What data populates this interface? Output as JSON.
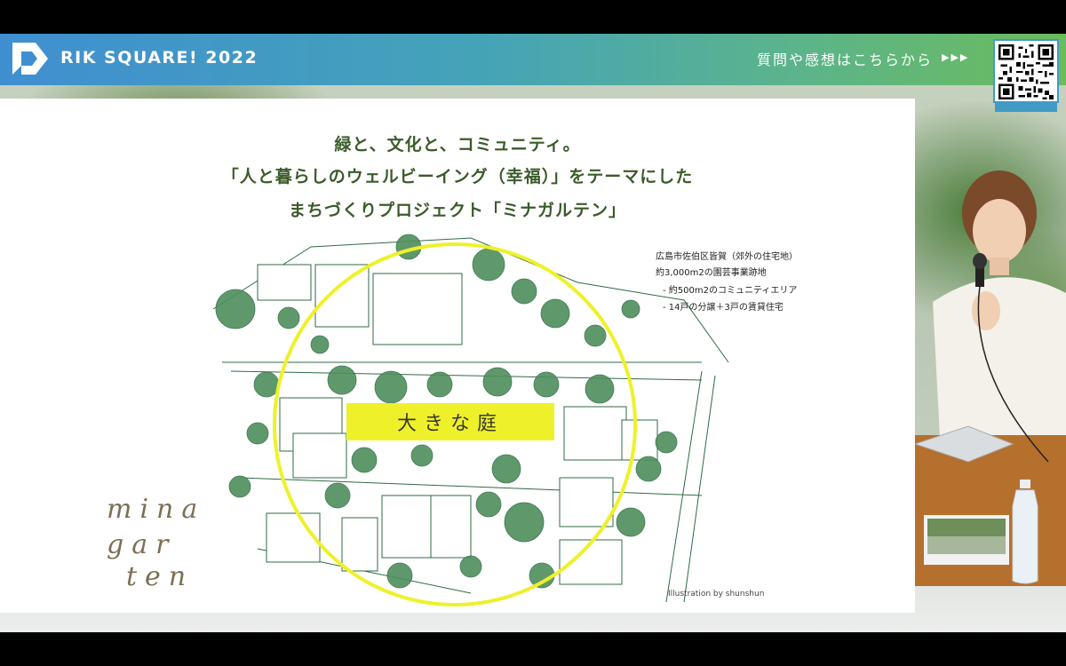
{
  "header": {
    "brand": "RIK SQUARE! 2022",
    "cta_text": "質問や感想はこちらから",
    "cta_arrows": "▶▶▶",
    "logo_icon": "rik-logo-icon",
    "qr_icon": "qr-code-icon"
  },
  "slide": {
    "title_line1": "緑と、文化と、コミュニティ。",
    "title_line2": "「人と暮らしのウェルビーイング（幸福）」をテーマにした",
    "title_line3": "まちづくりプロジェクト「ミナガルテン」",
    "info_line1": "広島市佐伯区皆賀（郊外の住宅地）",
    "info_line2": "約3,000m2の園芸事業跡地",
    "info_line3": "-  約500m2のコミュニティエリア",
    "info_line4": "-  14戸の分譲＋3戸の賃貸住宅",
    "garden_label": "大きな庭",
    "credit": "Illustration by shunshun",
    "logo_line1": "mina",
    "logo_line2": "gar",
    "logo_line3": "ten"
  },
  "colors": {
    "banner_start": "#3f8fd0",
    "banner_end": "#6cbb5c",
    "title_green": "#3b5b2a",
    "circle_yellow": "#eef12a",
    "illustration_green": "#2f6b45"
  }
}
